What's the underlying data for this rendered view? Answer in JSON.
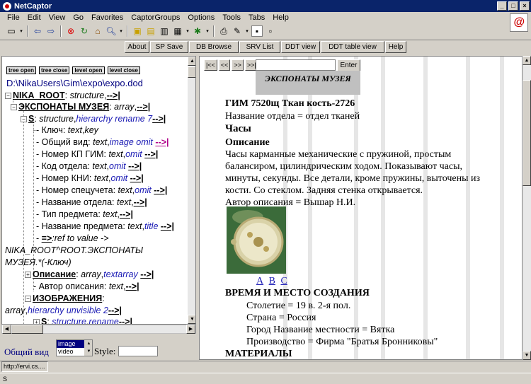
{
  "window": {
    "title": "NetCaptor"
  },
  "menu": [
    "File",
    "Edit",
    "View",
    "Go",
    "Favorites",
    "CaptorGroups",
    "Options",
    "Tools",
    "Tabs",
    "Help"
  ],
  "navbar": [
    "About",
    "SP Save",
    "DB Browse",
    "SRV List",
    "DDT view",
    "DDT table view",
    "Help"
  ],
  "tree": {
    "buttons": [
      "tree open",
      "tree close",
      "level open",
      "level close"
    ],
    "path": "D:\\NikaUsers\\Gim\\expo\\expo.dod",
    "root": {
      "name": "NIKA_ROOT",
      "type": "structure",
      "link": "-->|"
    },
    "exhibits": {
      "name": "ЭКСПОНАТЫ МУЗЕЯ",
      "type": "array",
      "link": "-->|"
    },
    "s": {
      "name": "S",
      "type": "structure",
      "mod": "hierarchy rename 7",
      "link": "-->|"
    },
    "fields": [
      {
        "name": "Ключ",
        "type": "text",
        "mod": "key",
        "link": ""
      },
      {
        "name": "Общий вид",
        "type": "text",
        "mod": "image omit",
        "link": "-->|"
      },
      {
        "name": "Номер КП ГИМ",
        "type": "text",
        "mod": "omit",
        "link": "-->|"
      },
      {
        "name": "Код отдела",
        "type": "text",
        "mod": "omit",
        "link": "-->|"
      },
      {
        "name": "Номер КНИ",
        "type": "text",
        "mod": "omit",
        "link": "-->|"
      },
      {
        "name": "Номер спецучета",
        "type": "text",
        "mod": "omit",
        "link": "-->|"
      },
      {
        "name": "Название отдела",
        "type": "text",
        "mod": "",
        "link": "-->|"
      },
      {
        "name": "Тип предмета",
        "type": "text",
        "mod": "",
        "link": "-->|"
      },
      {
        "name": "Название предмета",
        "type": "text",
        "mod": "title",
        "link": "-->|"
      }
    ],
    "ref": {
      "arrow": "=>",
      "text": ":ref to value ->",
      "line2": "NIKA_ROOT^ROOT.ЭКСПОНАТЫ",
      "line3": "МУЗЕЯ.*(-Ключ)"
    },
    "desc": {
      "name": "Описание",
      "type": "array",
      "mod": "textarray",
      "link": "-->|"
    },
    "author": {
      "name": "Автор описания",
      "type": "text",
      "link": "-->|"
    },
    "images": {
      "name": "ИЗОБРАЖЕНИЯ",
      "line2type": "array",
      "mod": "hierarchy unvisible 2",
      "link": "-->|"
    },
    "s2": {
      "name": "S",
      "type": "structure",
      "mod": "rename",
      "link": "-->|"
    }
  },
  "lower": {
    "label": "Общий вид",
    "options": [
      "image",
      "video"
    ],
    "style_label": "Style:"
  },
  "record": {
    "nav": [
      "|<<",
      "<<",
      ">>",
      ">>|"
    ],
    "enter": "Enter",
    "header": "ЭКСПОНАТЫ МУЗЕЯ",
    "id_line": "ГИМ 7520щ Ткан кость-2726",
    "dept": "Название отдела = отдел тканей",
    "title": "Часы",
    "desc_head": "Описание",
    "desc": [
      "Часы карманные механические с пружиной, простым",
      "балансиром, цилиндрическим ходом. Показывают часы,",
      "минуты, секунды. Все детали, кроме пружины, выточены из",
      "кости. Со стеклом. Задняя стенка открывается."
    ],
    "author": "Автор описания = Вышар Н.И.",
    "links": [
      "A",
      "B",
      "C"
    ],
    "section": "ВРЕМЯ И МЕСТО СОЗДАНИЯ",
    "century": "Столетие = 19 в. 2-я пол.",
    "country": "Страна = Россия",
    "city": "Город Название местности = Вятка",
    "maker": "Производство = Фирма \"Братья Бронниковы\"",
    "materials": "МАТЕРИАЛЫ"
  },
  "status": {
    "url": "http://ervi.cs....",
    "bottom": "S"
  }
}
